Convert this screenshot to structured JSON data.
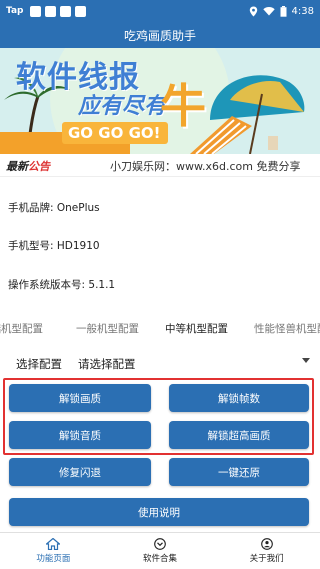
{
  "status_bar": {
    "app_badge": "Tap",
    "time": "4:38"
  },
  "app_bar": {
    "title": "吃鸡画质助手"
  },
  "banner": {
    "headline_1": "软件线报",
    "headline_2": "应有尽有",
    "big_char": "牛",
    "cta": "GO GO GO!"
  },
  "notice": {
    "badge_main": "最新",
    "badge_accent": "公告",
    "text": "小刀娱乐网：www.x6d.com  免费分享"
  },
  "device_info": {
    "brand_label": "手机品牌:",
    "brand": "OnePlus",
    "model_label": "手机型号:",
    "model": "HD1910",
    "os_label": "操作系统版本号:",
    "os": "5.1.1"
  },
  "tabs": [
    {
      "label": "低端机型配置"
    },
    {
      "label": "一般机型配置"
    },
    {
      "label": "中等机型配置"
    },
    {
      "label": "性能怪兽机型配置"
    }
  ],
  "config": {
    "label": "选择配置",
    "placeholder": "请选择配置"
  },
  "buttons": {
    "unlock_quality": "解锁画质",
    "unlock_fps": "解锁帧数",
    "unlock_audio": "解锁音质",
    "unlock_ultra": "解锁超高画质",
    "fix_crash": "修复闪退",
    "restore": "一键还原",
    "instructions": "使用说明"
  },
  "bottom_nav": [
    {
      "label": "功能页面",
      "icon": "home-icon"
    },
    {
      "label": "软件合集",
      "icon": "chevron-down-circle-icon"
    },
    {
      "label": "关于我们",
      "icon": "person-icon"
    }
  ],
  "colors": {
    "primary": "#2b6fb3",
    "highlight_border": "#e23131"
  }
}
